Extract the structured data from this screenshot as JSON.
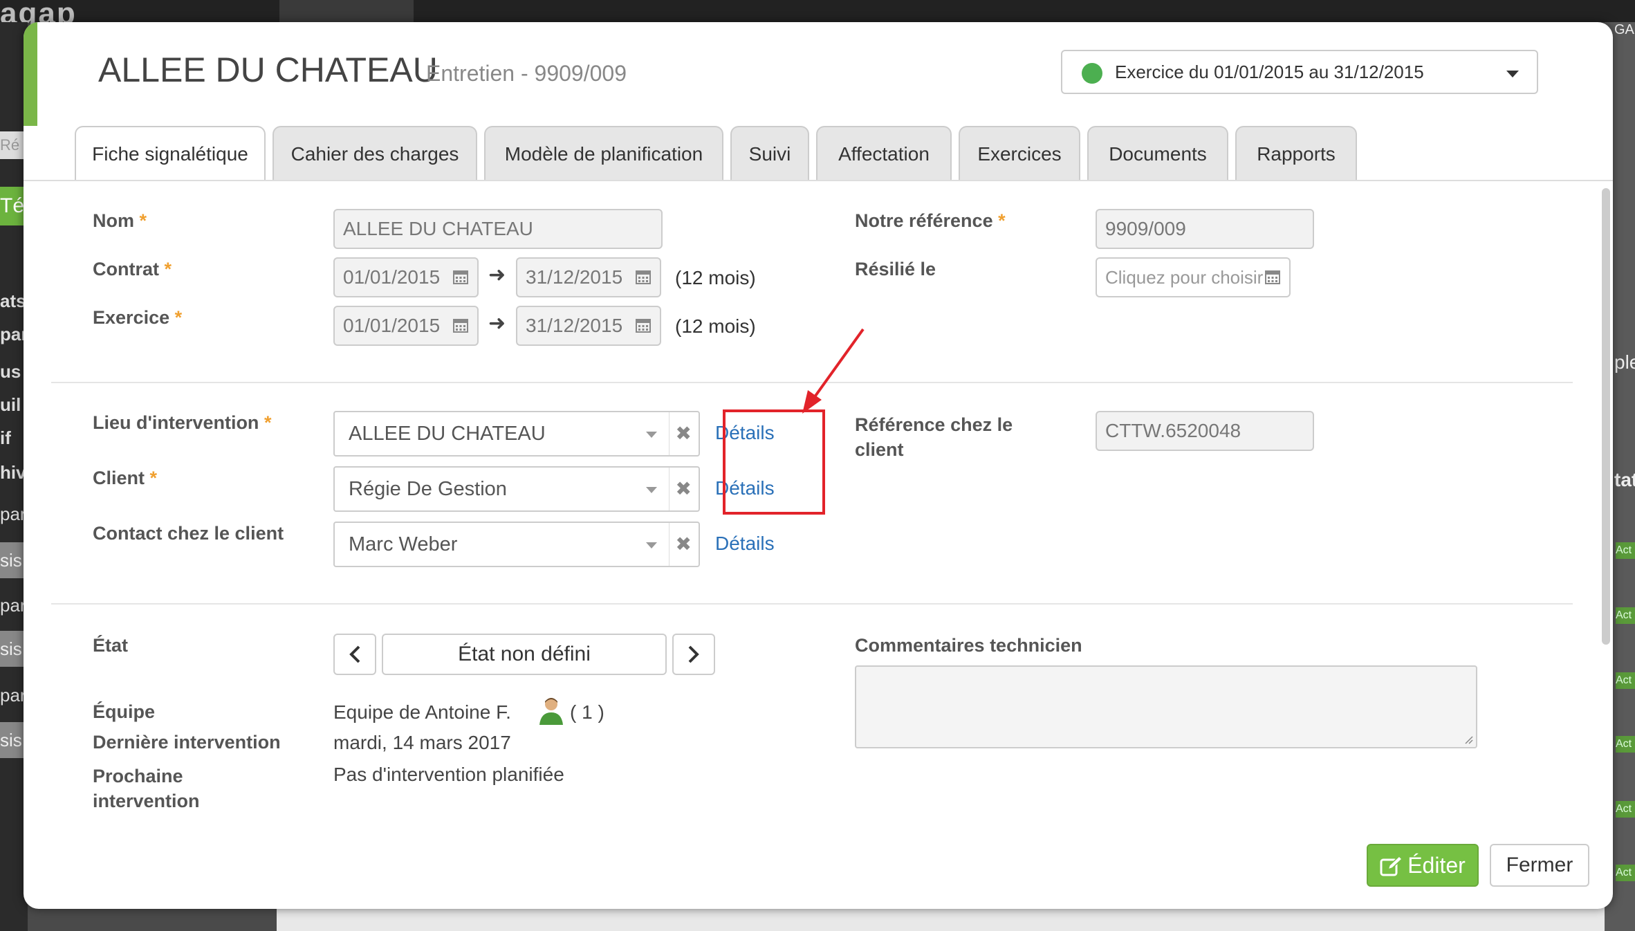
{
  "background": {
    "logo": "agap",
    "left_labels": [
      "Ré",
      "Té",
      "ats",
      "par",
      "us",
      "uil",
      "if",
      "hiv",
      "par",
      "sis",
      "par",
      "sis",
      "par",
      "sis"
    ],
    "right_labels": [
      "ple",
      "tat",
      "Act",
      "Act",
      "Act",
      "Act",
      "Act",
      "Act"
    ],
    "right_top": "GA"
  },
  "header": {
    "title": "ALLEE DU CHATEAU",
    "subtitle": "Entretien - 9909/009",
    "exercice_select": "Exercice du 01/01/2015 au 31/12/2015",
    "status_color": "#4caf50"
  },
  "tabs": [
    {
      "label": "Fiche signalétique",
      "active": true
    },
    {
      "label": "Cahier des charges"
    },
    {
      "label": "Modèle de planification"
    },
    {
      "label": "Suivi"
    },
    {
      "label": "Affectation"
    },
    {
      "label": "Exercices"
    },
    {
      "label": "Documents"
    },
    {
      "label": "Rapports"
    }
  ],
  "form": {
    "nom_label": "Nom",
    "nom_value": "ALLEE DU CHATEAU",
    "contrat_label": "Contrat",
    "contrat_start": "01/01/2015",
    "contrat_end": "31/12/2015",
    "contrat_duration": "(12 mois)",
    "exercice_label": "Exercice",
    "exercice_start": "01/01/2015",
    "exercice_end": "31/12/2015",
    "exercice_duration": "(12 mois)",
    "notre_ref_label": "Notre référence",
    "notre_ref_value": "9909/009",
    "resilie_label": "Résilié le",
    "resilie_placeholder": "Cliquez pour choisir",
    "lieu_label": "Lieu d'intervention",
    "lieu_value": "ALLEE DU CHATEAU",
    "client_label": "Client",
    "client_value": "Régie De Gestion",
    "contact_label": "Contact chez le client",
    "contact_value": "Marc Weber",
    "details_label": "Détails",
    "ref_client_label_1": "Référence chez le",
    "ref_client_label_2": "client",
    "ref_client_value": "CTTW.6520048",
    "etat_label": "État",
    "etat_value": "État non défini",
    "equipe_label": "Équipe",
    "equipe_value": "Equipe de Antoine F.",
    "equipe_count": "( 1 )",
    "derniere_label": "Dernière intervention",
    "derniere_value": "mardi, 14 mars 2017",
    "prochaine_label_1": "Prochaine",
    "prochaine_label_2": "intervention",
    "prochaine_value": "Pas d'intervention planifiée",
    "commentaires_label": "Commentaires technicien",
    "required_mark": "*"
  },
  "footer": {
    "edit_label": "Éditer",
    "close_label": "Fermer"
  },
  "colors": {
    "accent_green": "#7ab648",
    "edit_button": "#76c043",
    "link": "#2a70b8",
    "highlight_red": "#e2232a"
  }
}
